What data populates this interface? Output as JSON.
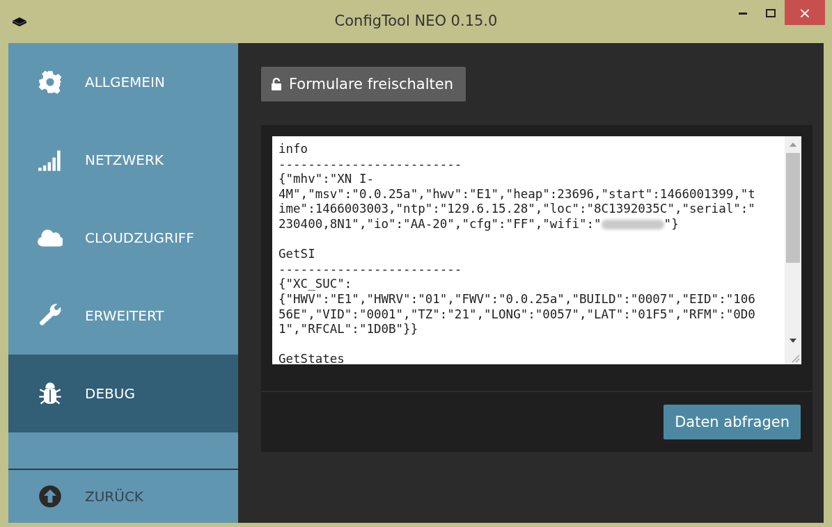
{
  "window": {
    "title": "ConfigTool NEO 0.15.0",
    "close_label": "×"
  },
  "sidebar": {
    "items": [
      {
        "kind": "gear",
        "label": "ALLGEMEIN",
        "selected": false
      },
      {
        "kind": "signal",
        "label": "NETZWERK",
        "selected": false
      },
      {
        "kind": "cloud",
        "label": "CLOUDZUGRIFF",
        "selected": false
      },
      {
        "kind": "wrench",
        "label": "ERWEITERT",
        "selected": false
      },
      {
        "kind": "bug",
        "label": "DEBUG",
        "selected": true
      }
    ],
    "back": {
      "label": "ZURÜCK"
    }
  },
  "unlock_button": "Formulare freischalten",
  "log": {
    "lines": [
      {
        "kind": "text",
        "text": "info"
      },
      {
        "kind": "text",
        "text": "-------------------------"
      },
      {
        "kind": "text",
        "text": "{\"mhv\":\"XN I-"
      },
      {
        "kind": "text",
        "text": "4M\",\"msv\":\"0.0.25a\",\"hwv\":\"E1\",\"heap\":23696,\"start\":1466001399,\"t"
      },
      {
        "kind": "text",
        "text": "ime\":1466003003,\"ntp\":\"129.6.15.28\",\"loc\":\"8C1392035C\",\"serial\":\""
      },
      {
        "kind": "text",
        "text": "230400,8N1\",\"io\":\"AA-20\",\"cfg\":\"FF\",\"wifi\":\"",
        "redacted": true,
        "tail": "\"}"
      },
      {
        "kind": "blank"
      },
      {
        "kind": "text",
        "text": "GetSI"
      },
      {
        "kind": "text",
        "text": "-------------------------"
      },
      {
        "kind": "text",
        "text": "{\"XC_SUC\":"
      },
      {
        "kind": "text",
        "text": "{\"HWV\":\"E1\",\"HWRV\":\"01\",\"FWV\":\"0.0.25a\",\"BUILD\":\"0007\",\"EID\":\"106"
      },
      {
        "kind": "text",
        "text": "56E\",\"VID\":\"0001\",\"TZ\":\"21\",\"LONG\":\"0057\",\"LAT\":\"01F5\",\"RFM\":\"0D0"
      },
      {
        "kind": "text",
        "text": "1\",\"RFCAL\":\"1D0B\"}}"
      },
      {
        "kind": "blank"
      },
      {
        "kind": "text",
        "text": "GetStates"
      }
    ]
  },
  "fetch_button": "Daten abfragen"
}
